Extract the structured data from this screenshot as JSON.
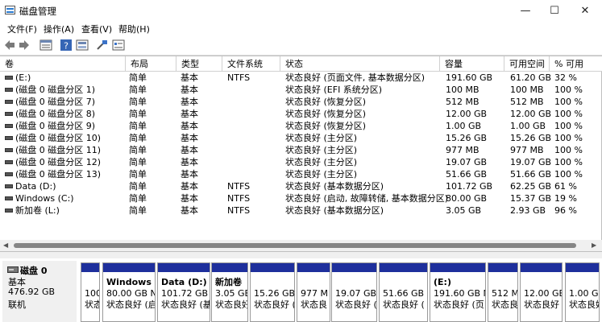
{
  "window": {
    "title": "磁盘管理",
    "minimize": "—",
    "maximize": "☐",
    "close": "✕"
  },
  "menu": [
    "文件(F)",
    "操作(A)",
    "查看(V)",
    "帮助(H)"
  ],
  "toolbar_icons": [
    "back-arrow-icon",
    "forward-arrow-icon",
    "volume-list-icon",
    "help-icon",
    "disk-list-icon",
    "rescan-icon",
    "properties-icon"
  ],
  "columns": [
    "卷",
    "布局",
    "类型",
    "文件系统",
    "状态",
    "容量",
    "可用空间",
    "% 可用"
  ],
  "volumes": [
    [
      "(E:)",
      "简单",
      "基本",
      "NTFS",
      "状态良好 (页面文件, 基本数据分区)",
      "191.60 GB",
      "61.20 GB",
      "32 %"
    ],
    [
      "(磁盘 0 磁盘分区 1)",
      "简单",
      "基本",
      "",
      "状态良好 (EFI 系统分区)",
      "100 MB",
      "100 MB",
      "100 %"
    ],
    [
      "(磁盘 0 磁盘分区 7)",
      "简单",
      "基本",
      "",
      "状态良好 (恢复分区)",
      "512 MB",
      "512 MB",
      "100 %"
    ],
    [
      "(磁盘 0 磁盘分区 8)",
      "简单",
      "基本",
      "",
      "状态良好 (恢复分区)",
      "12.00 GB",
      "12.00 GB",
      "100 %"
    ],
    [
      "(磁盘 0 磁盘分区 9)",
      "简单",
      "基本",
      "",
      "状态良好 (恢复分区)",
      "1.00 GB",
      "1.00 GB",
      "100 %"
    ],
    [
      "(磁盘 0 磁盘分区 10)",
      "简单",
      "基本",
      "",
      "状态良好 (主分区)",
      "15.26 GB",
      "15.26 GB",
      "100 %"
    ],
    [
      "(磁盘 0 磁盘分区 11)",
      "简单",
      "基本",
      "",
      "状态良好 (主分区)",
      "977 MB",
      "977 MB",
      "100 %"
    ],
    [
      "(磁盘 0 磁盘分区 12)",
      "简单",
      "基本",
      "",
      "状态良好 (主分区)",
      "19.07 GB",
      "19.07 GB",
      "100 %"
    ],
    [
      "(磁盘 0 磁盘分区 13)",
      "简单",
      "基本",
      "",
      "状态良好 (主分区)",
      "51.66 GB",
      "51.66 GB",
      "100 %"
    ],
    [
      "Data (D:)",
      "简单",
      "基本",
      "NTFS",
      "状态良好 (基本数据分区)",
      "101.72 GB",
      "62.25 GB",
      "61 %"
    ],
    [
      "Windows (C:)",
      "简单",
      "基本",
      "NTFS",
      "状态良好 (启动, 故障转储, 基本数据分区)",
      "80.00 GB",
      "15.37 GB",
      "19 %"
    ],
    [
      "新加卷 (L:)",
      "简单",
      "基本",
      "NTFS",
      "状态良好 (基本数据分区)",
      "3.05 GB",
      "2.93 GB",
      "96 %"
    ]
  ],
  "disk": {
    "name": "磁盘 0",
    "type": "基本",
    "size": "476.92 GB",
    "status": "联机"
  },
  "partitions": [
    {
      "label": "",
      "size": "100",
      "status": "状态"
    },
    {
      "label": "Windows",
      "size": "80.00 GB N",
      "status": "状态良好 (启"
    },
    {
      "label": "Data  (D:)",
      "size": "101.72 GB N",
      "status": "状态良好 (基"
    },
    {
      "label": "新加卷",
      "size": "3.05 GB",
      "status": "状态良好"
    },
    {
      "label": "",
      "size": "15.26 GB",
      "status": "状态良好 ("
    },
    {
      "label": "",
      "size": "977 M",
      "status": "状态良"
    },
    {
      "label": "",
      "size": "19.07 GB",
      "status": "状态良好 ("
    },
    {
      "label": "",
      "size": "51.66 GB",
      "status": "状态良好 ("
    },
    {
      "label": "(E:)",
      "size": "191.60 GB N",
      "status": "状态良好 (页"
    },
    {
      "label": "",
      "size": "512 M",
      "status": "状态良"
    },
    {
      "label": "",
      "size": "12.00 GB",
      "status": "状态良好 ("
    },
    {
      "label": "",
      "size": "1.00 GB",
      "status": "状态良好"
    }
  ],
  "colors": {
    "partition_band": "#1e2f9c"
  }
}
